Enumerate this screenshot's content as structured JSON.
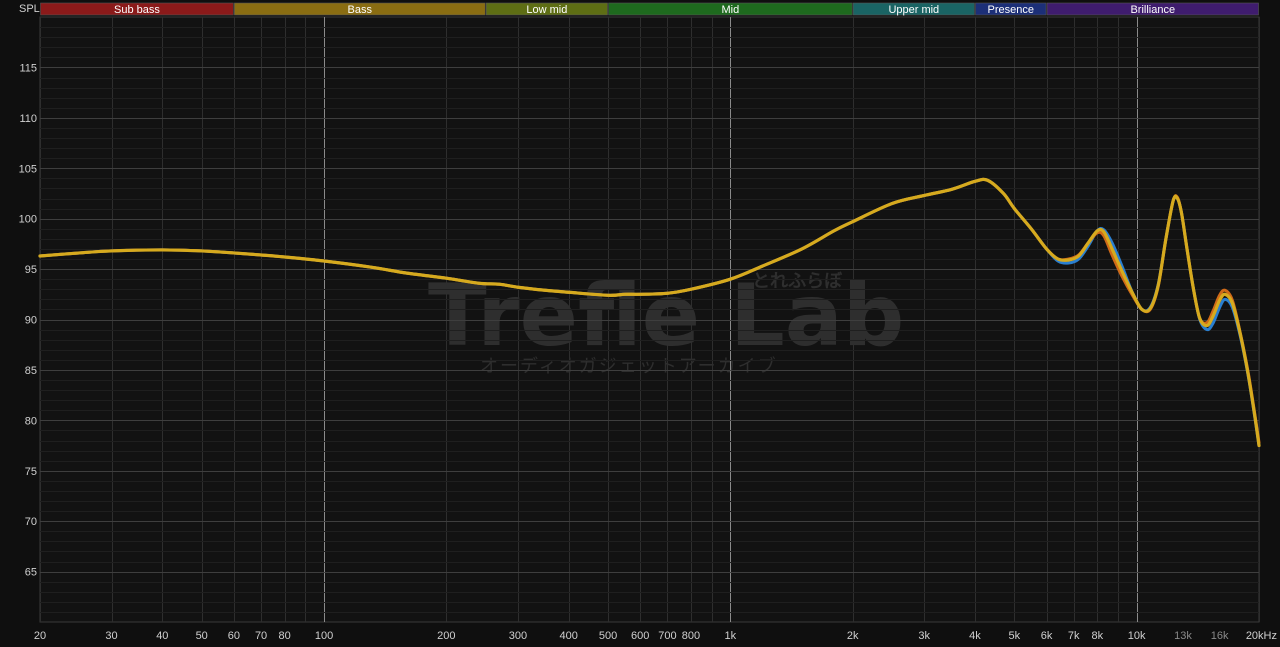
{
  "chart_data": {
    "type": "line",
    "y_axis_label": "SPL",
    "x_scale": "log",
    "xlim": [
      20,
      20000
    ],
    "ylim": [
      60,
      120
    ],
    "y_ticks": [
      65,
      70,
      75,
      80,
      85,
      90,
      95,
      100,
      105,
      110,
      115
    ],
    "x_ticks": [
      {
        "value": 20,
        "label": "20",
        "dim": false
      },
      {
        "value": 30,
        "label": "30",
        "dim": false
      },
      {
        "value": 40,
        "label": "40",
        "dim": false
      },
      {
        "value": 50,
        "label": "50",
        "dim": false
      },
      {
        "value": 60,
        "label": "60",
        "dim": false
      },
      {
        "value": 70,
        "label": "70",
        "dim": false
      },
      {
        "value": 80,
        "label": "80",
        "dim": false
      },
      {
        "value": 100,
        "label": "100",
        "dim": false
      },
      {
        "value": 200,
        "label": "200",
        "dim": false
      },
      {
        "value": 300,
        "label": "300",
        "dim": false
      },
      {
        "value": 400,
        "label": "400",
        "dim": false
      },
      {
        "value": 500,
        "label": "500",
        "dim": false
      },
      {
        "value": 600,
        "label": "600",
        "dim": false
      },
      {
        "value": 700,
        "label": "700",
        "dim": false
      },
      {
        "value": 800,
        "label": "800",
        "dim": false
      },
      {
        "value": 1000,
        "label": "1k",
        "dim": false
      },
      {
        "value": 2000,
        "label": "2k",
        "dim": false
      },
      {
        "value": 3000,
        "label": "3k",
        "dim": false
      },
      {
        "value": 4000,
        "label": "4k",
        "dim": false
      },
      {
        "value": 5000,
        "label": "5k",
        "dim": false
      },
      {
        "value": 6000,
        "label": "6k",
        "dim": false
      },
      {
        "value": 7000,
        "label": "7k",
        "dim": false
      },
      {
        "value": 8000,
        "label": "8k",
        "dim": false
      },
      {
        "value": 10000,
        "label": "10k",
        "dim": false
      },
      {
        "value": 13000,
        "label": "13k",
        "dim": true
      },
      {
        "value": 16000,
        "label": "16k",
        "dim": true
      },
      {
        "value": 20000,
        "label": "20kHz",
        "dim": false
      }
    ],
    "grid": true,
    "bands": [
      {
        "label": "Sub bass",
        "from": 20,
        "to": 60,
        "color": "#8b1a1a"
      },
      {
        "label": "Bass",
        "from": 60,
        "to": 250,
        "color": "#8a6d12"
      },
      {
        "label": "Low mid",
        "from": 250,
        "to": 500,
        "color": "#5e6e14"
      },
      {
        "label": "Mid",
        "from": 500,
        "to": 2000,
        "color": "#1e6a1e"
      },
      {
        "label": "Upper mid",
        "from": 2000,
        "to": 4000,
        "color": "#1a6464"
      },
      {
        "label": "Presence",
        "from": 4000,
        "to": 6000,
        "color": "#1c2f78"
      },
      {
        "label": "Brilliance",
        "from": 6000,
        "to": 20000,
        "color": "#3f1c6e"
      }
    ],
    "series": [
      {
        "color": "#2a7fd0",
        "points": [
          [
            20,
            96.3
          ],
          [
            25,
            96.6
          ],
          [
            30,
            96.8
          ],
          [
            40,
            96.9
          ],
          [
            50,
            96.8
          ],
          [
            60,
            96.6
          ],
          [
            70,
            96.4
          ],
          [
            80,
            96.2
          ],
          [
            100,
            95.8
          ],
          [
            130,
            95.2
          ],
          [
            160,
            94.6
          ],
          [
            200,
            94.1
          ],
          [
            240,
            93.6
          ],
          [
            270,
            93.5
          ],
          [
            300,
            93.2
          ],
          [
            350,
            92.9
          ],
          [
            400,
            92.7
          ],
          [
            500,
            92.4
          ],
          [
            550,
            92.5
          ],
          [
            600,
            92.5
          ],
          [
            700,
            92.6
          ],
          [
            800,
            93.0
          ],
          [
            1000,
            94.0
          ],
          [
            1200,
            95.3
          ],
          [
            1500,
            97.0
          ],
          [
            1800,
            98.8
          ],
          [
            2000,
            99.7
          ],
          [
            2500,
            101.5
          ],
          [
            3000,
            102.3
          ],
          [
            3500,
            102.9
          ],
          [
            4000,
            103.7
          ],
          [
            4300,
            103.8
          ],
          [
            4700,
            102.5
          ],
          [
            5000,
            101.0
          ],
          [
            5500,
            99.0
          ],
          [
            6000,
            97.0
          ],
          [
            6400,
            95.8
          ],
          [
            6800,
            95.6
          ],
          [
            7200,
            96.0
          ],
          [
            7600,
            97.3
          ],
          [
            8000,
            98.8
          ],
          [
            8300,
            98.9
          ],
          [
            8700,
            97.6
          ],
          [
            9200,
            95.3
          ],
          [
            9800,
            92.5
          ],
          [
            10300,
            91.0
          ],
          [
            10800,
            91.2
          ],
          [
            11300,
            93.5
          ],
          [
            11800,
            98.0
          ],
          [
            12300,
            101.8
          ],
          [
            12600,
            102.0
          ],
          [
            12900,
            100.5
          ],
          [
            13300,
            97.0
          ],
          [
            13800,
            93.0
          ],
          [
            14300,
            90.0
          ],
          [
            14900,
            89.0
          ],
          [
            15400,
            89.6
          ],
          [
            16000,
            91.2
          ],
          [
            16500,
            92.0
          ],
          [
            17200,
            91.2
          ],
          [
            18000,
            88.3
          ],
          [
            18800,
            84.5
          ],
          [
            19500,
            80.5
          ],
          [
            20000,
            77.5
          ]
        ]
      },
      {
        "color": "#d06a18",
        "points": [
          [
            20,
            96.3
          ],
          [
            25,
            96.6
          ],
          [
            30,
            96.8
          ],
          [
            40,
            96.9
          ],
          [
            50,
            96.8
          ],
          [
            60,
            96.6
          ],
          [
            70,
            96.4
          ],
          [
            80,
            96.2
          ],
          [
            100,
            95.8
          ],
          [
            130,
            95.2
          ],
          [
            160,
            94.6
          ],
          [
            200,
            94.1
          ],
          [
            240,
            93.6
          ],
          [
            270,
            93.5
          ],
          [
            300,
            93.2
          ],
          [
            350,
            92.9
          ],
          [
            400,
            92.7
          ],
          [
            500,
            92.4
          ],
          [
            550,
            92.5
          ],
          [
            600,
            92.5
          ],
          [
            700,
            92.6
          ],
          [
            800,
            93.0
          ],
          [
            1000,
            94.0
          ],
          [
            1200,
            95.3
          ],
          [
            1500,
            97.0
          ],
          [
            1800,
            98.8
          ],
          [
            2000,
            99.7
          ],
          [
            2500,
            101.5
          ],
          [
            3000,
            102.3
          ],
          [
            3500,
            102.9
          ],
          [
            4000,
            103.7
          ],
          [
            4300,
            103.8
          ],
          [
            4700,
            102.5
          ],
          [
            5000,
            101.0
          ],
          [
            5500,
            99.0
          ],
          [
            6000,
            97.0
          ],
          [
            6400,
            96.0
          ],
          [
            6800,
            96.0
          ],
          [
            7200,
            96.4
          ],
          [
            7600,
            97.6
          ],
          [
            8000,
            98.6
          ],
          [
            8300,
            98.3
          ],
          [
            8700,
            96.4
          ],
          [
            9200,
            94.3
          ],
          [
            9800,
            92.3
          ],
          [
            10300,
            91.0
          ],
          [
            10800,
            91.0
          ],
          [
            11300,
            93.3
          ],
          [
            11800,
            98.0
          ],
          [
            12300,
            101.8
          ],
          [
            12600,
            102.1
          ],
          [
            12900,
            100.5
          ],
          [
            13300,
            97.0
          ],
          [
            13800,
            93.0
          ],
          [
            14300,
            90.1
          ],
          [
            14900,
            89.7
          ],
          [
            15400,
            90.8
          ],
          [
            16000,
            92.4
          ],
          [
            16500,
            92.9
          ],
          [
            17200,
            91.9
          ],
          [
            18000,
            88.6
          ],
          [
            18800,
            84.8
          ],
          [
            19500,
            80.8
          ],
          [
            20000,
            77.8
          ]
        ]
      },
      {
        "color": "#d6aa1e",
        "points": [
          [
            20,
            96.3
          ],
          [
            25,
            96.6
          ],
          [
            30,
            96.8
          ],
          [
            40,
            96.9
          ],
          [
            50,
            96.8
          ],
          [
            60,
            96.6
          ],
          [
            70,
            96.4
          ],
          [
            80,
            96.2
          ],
          [
            100,
            95.8
          ],
          [
            130,
            95.2
          ],
          [
            160,
            94.6
          ],
          [
            200,
            94.1
          ],
          [
            240,
            93.6
          ],
          [
            270,
            93.5
          ],
          [
            300,
            93.2
          ],
          [
            350,
            92.9
          ],
          [
            400,
            92.7
          ],
          [
            500,
            92.4
          ],
          [
            550,
            92.5
          ],
          [
            600,
            92.5
          ],
          [
            700,
            92.6
          ],
          [
            800,
            93.0
          ],
          [
            1000,
            94.0
          ],
          [
            1200,
            95.3
          ],
          [
            1500,
            97.0
          ],
          [
            1800,
            98.8
          ],
          [
            2000,
            99.7
          ],
          [
            2500,
            101.5
          ],
          [
            3000,
            102.3
          ],
          [
            3500,
            102.9
          ],
          [
            4000,
            103.7
          ],
          [
            4300,
            103.8
          ],
          [
            4700,
            102.5
          ],
          [
            5000,
            101.0
          ],
          [
            5500,
            99.0
          ],
          [
            6000,
            97.0
          ],
          [
            6400,
            96.0
          ],
          [
            6800,
            95.9
          ],
          [
            7200,
            96.3
          ],
          [
            7600,
            97.6
          ],
          [
            8000,
            98.8
          ],
          [
            8300,
            98.7
          ],
          [
            8700,
            97.0
          ],
          [
            9200,
            94.8
          ],
          [
            9800,
            92.5
          ],
          [
            10300,
            91.0
          ],
          [
            10800,
            91.1
          ],
          [
            11300,
            93.4
          ],
          [
            11800,
            98.0
          ],
          [
            12300,
            101.8
          ],
          [
            12600,
            102.0
          ],
          [
            12900,
            100.5
          ],
          [
            13300,
            97.0
          ],
          [
            13800,
            93.0
          ],
          [
            14300,
            90.1
          ],
          [
            14900,
            89.4
          ],
          [
            15400,
            90.3
          ],
          [
            16000,
            91.9
          ],
          [
            16500,
            92.5
          ],
          [
            17200,
            91.6
          ],
          [
            18000,
            88.5
          ],
          [
            18800,
            84.6
          ],
          [
            19500,
            80.6
          ],
          [
            20000,
            77.5
          ]
        ]
      }
    ]
  },
  "watermark": {
    "main": "Trefle Lab",
    "kana_small": "とれふらぼ",
    "sub": "オーディオガジェットアーカイブ"
  }
}
